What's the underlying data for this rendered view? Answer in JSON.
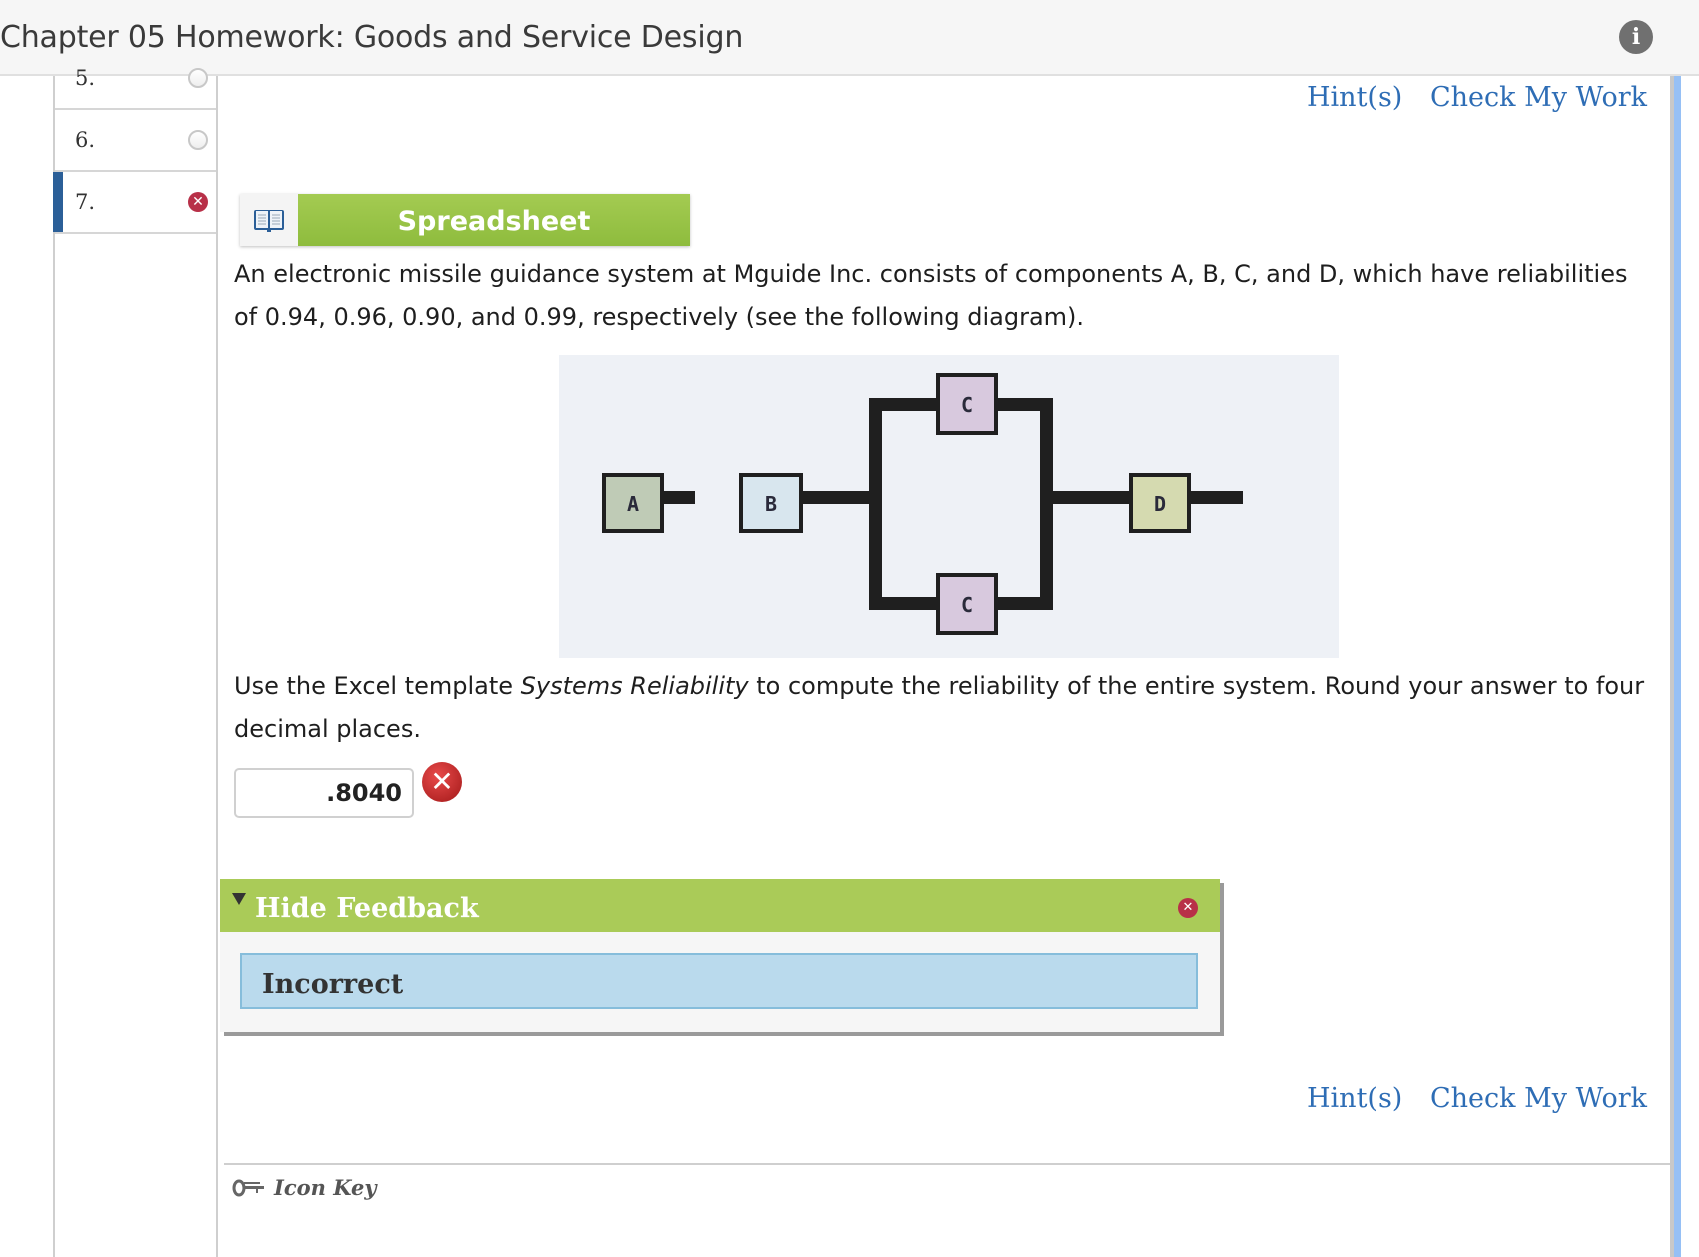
{
  "header": {
    "title": "Chapter 05 Homework: Goods and Service Design",
    "info_icon": "info-icon"
  },
  "question_nav": {
    "items": [
      {
        "number": "5.",
        "status": "unanswered"
      },
      {
        "number": "6.",
        "status": "unanswered"
      },
      {
        "number": "7.",
        "status": "incorrect",
        "active": true
      }
    ]
  },
  "actions_top": {
    "hint": "Hint(s)",
    "check": "Check My Work"
  },
  "spreadsheet": {
    "icon": "book-icon",
    "label": "Spreadsheet"
  },
  "question": {
    "intro": "An electronic missile guidance system at Mguide Inc. consists of components A, B, C, and D, which have reliabilities of 0.94, 0.96, 0.90, and 0.99, respectively (see the following diagram).",
    "instruction_pre": "Use the Excel template ",
    "instruction_template": "Systems Reliability",
    "instruction_post": " to compute the reliability of the entire system. Round your answer to four decimal places."
  },
  "diagram": {
    "components": [
      {
        "label": "A",
        "color": "#bfcbb6"
      },
      {
        "label": "B",
        "color": "#d8e6ee"
      },
      {
        "label": "C",
        "color": "#d8c9de"
      },
      {
        "label": "C",
        "color": "#d8c9de"
      },
      {
        "label": "D",
        "color": "#d5dab0"
      }
    ]
  },
  "answer": {
    "value": ".8040",
    "status": "incorrect"
  },
  "feedback": {
    "toggle_label": "Hide Feedback",
    "result": "Incorrect"
  },
  "actions_bottom": {
    "hint": "Hint(s)",
    "check": "Check My Work"
  },
  "footer": {
    "icon_key": "Icon Key"
  }
}
